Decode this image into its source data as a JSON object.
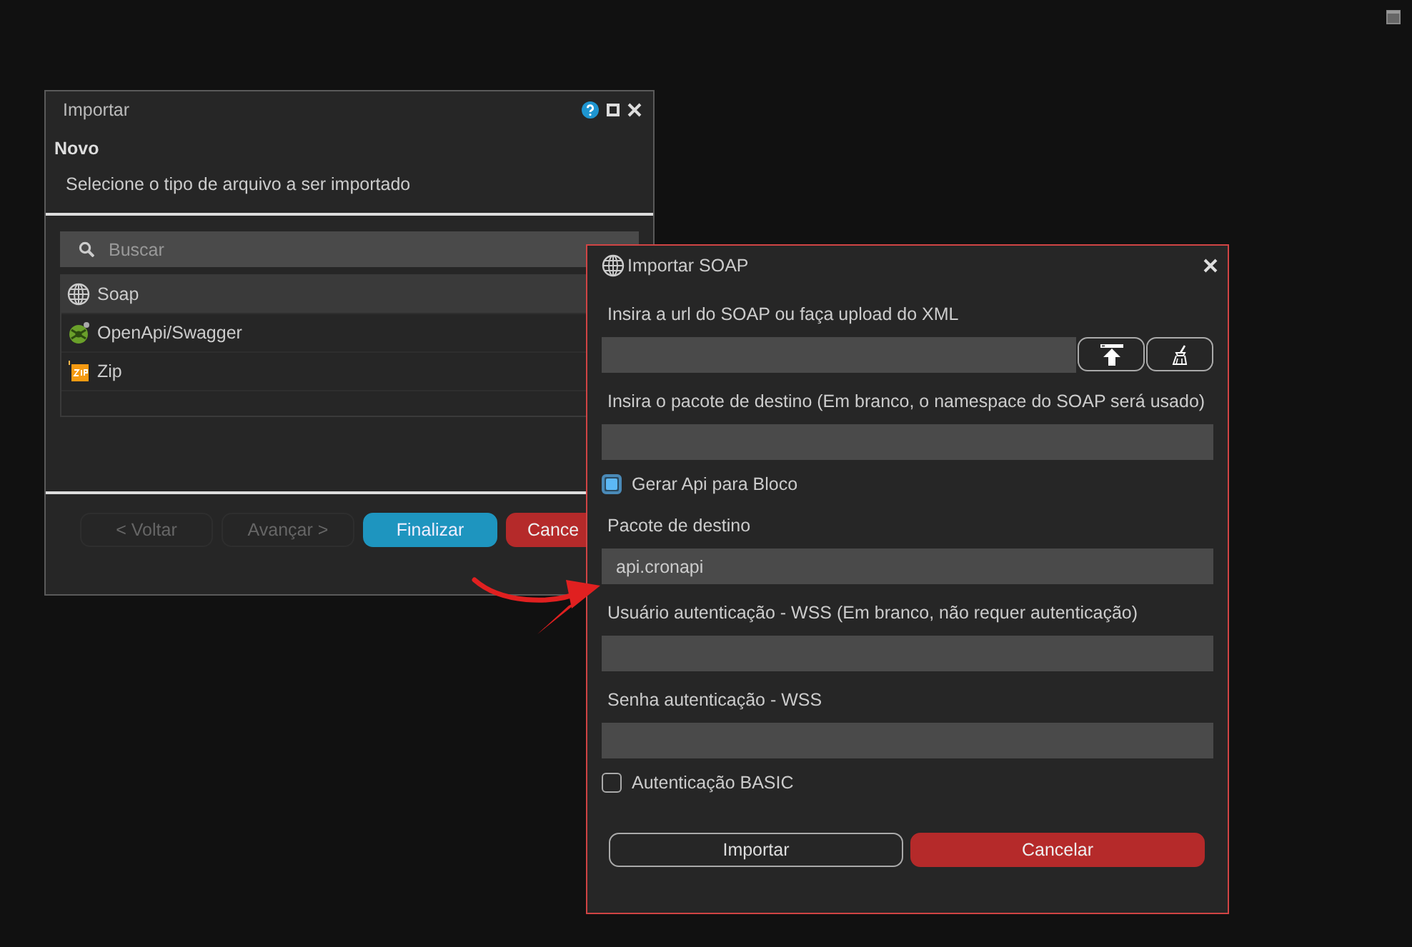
{
  "back_dialog": {
    "title": "Importar",
    "heading": "Novo",
    "subtitle": "Selecione o tipo de arquivo a ser importado",
    "search": {
      "placeholder": "Buscar"
    },
    "items": [
      {
        "label": "Soap",
        "kind": "globe",
        "selected": true
      },
      {
        "label": "OpenApi/Swagger",
        "kind": "swagger",
        "selected": false
      },
      {
        "label": "Zip",
        "kind": "zip",
        "selected": false
      }
    ],
    "buttons": [
      {
        "label": "< Voltar",
        "kind": "plain",
        "disabled": true
      },
      {
        "label": "Avançar >",
        "kind": "plain",
        "disabled": true
      },
      {
        "label": "Finalizar",
        "kind": "primary",
        "disabled": false
      },
      {
        "label": "Cance",
        "kind": "danger",
        "disabled": false
      }
    ]
  },
  "soap_dialog": {
    "title": "Importar SOAP",
    "rows": [
      {
        "kind": "field",
        "label": "Insira a url do SOAP ou faça upload do XML",
        "upload": true
      },
      {
        "kind": "field",
        "label": "Insira o pacote de destino (Em branco, o namespace do SOAP será usado)"
      },
      {
        "kind": "checkbox",
        "label": "Gerar Api para Bloco",
        "checked": true
      },
      {
        "kind": "field",
        "label": "Pacote de destino",
        "value": "api.cronapi"
      },
      {
        "kind": "field",
        "label": "Usuário autenticação - WSS (Em branco, não requer autenticação)"
      },
      {
        "kind": "field",
        "label": "Senha autenticação - WSS"
      },
      {
        "kind": "checkbox",
        "label": "Autenticação BASIC",
        "checked": false
      }
    ],
    "buttons": [
      {
        "label": "Importar",
        "kind": "outline"
      },
      {
        "label": "Cancelar",
        "kind": "danger"
      }
    ]
  }
}
